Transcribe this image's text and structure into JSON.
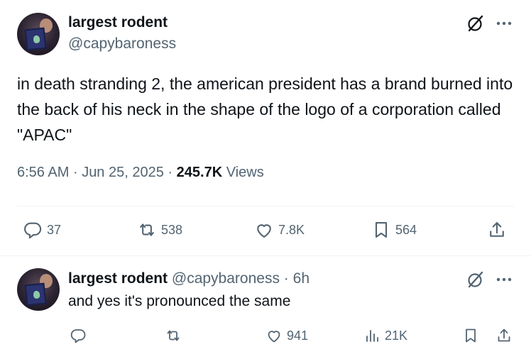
{
  "main_tweet": {
    "display_name": "largest rodent",
    "handle": "@capybaroness",
    "text": "in death stranding 2, the american president has a brand burned into the back of his neck in the shape of the logo of a corporation called \"APAC\"",
    "time": "6:56 AM",
    "separator": "·",
    "date": "Jun 25, 2025",
    "views_count": "245.7K",
    "views_label": "Views",
    "actions": {
      "replies": "37",
      "reposts": "538",
      "likes": "7.8K",
      "bookmarks": "564"
    }
  },
  "reply_tweet": {
    "display_name": "largest rodent",
    "handle": "@capybaroness",
    "separator": "·",
    "time_ago": "6h",
    "text": "and yes it's pronounced the same",
    "actions": {
      "likes": "941",
      "views": "21K"
    }
  },
  "icons": {
    "reply": "reply-icon",
    "repost": "repost-icon",
    "like": "heart-icon",
    "bookmark": "bookmark-icon",
    "share": "share-icon",
    "views": "analytics-icon",
    "grok": "grok-icon",
    "more": "more-icon"
  },
  "colors": {
    "text_primary": "#0f1419",
    "text_secondary": "#536471",
    "divider": "#eff3f4"
  }
}
